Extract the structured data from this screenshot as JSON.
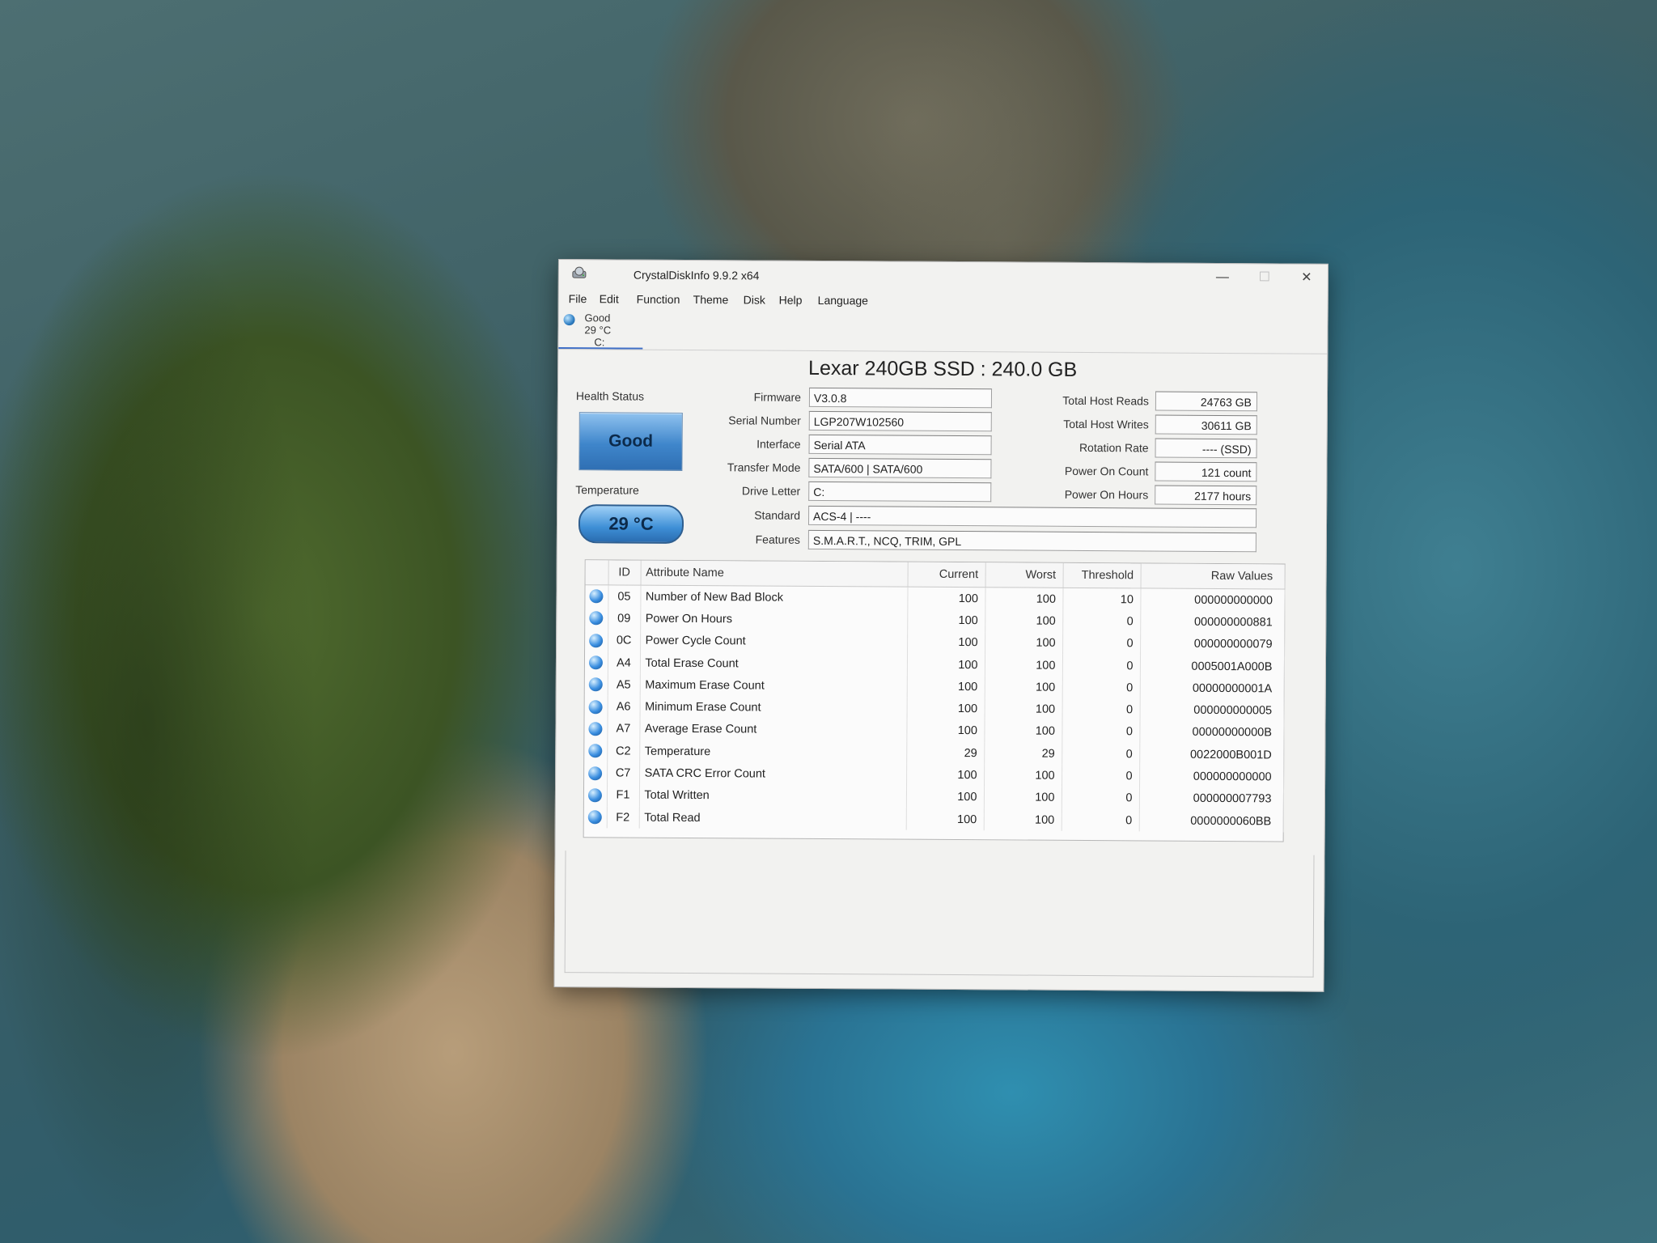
{
  "app": {
    "title": "CrystalDiskInfo 9.9.2 x64"
  },
  "window_controls": {
    "minimize": "—",
    "maximize": "☐",
    "close": "✕"
  },
  "menu": [
    "File",
    "Edit",
    "Function",
    "Theme",
    "Disk",
    "Help",
    "Language"
  ],
  "drive_tab": {
    "status": "Good",
    "temp": "29 °C",
    "letter": "C:"
  },
  "model_title": "Lexar 240GB SSD : 240.0 GB",
  "health": {
    "label": "Health Status",
    "value": "Good"
  },
  "temperature": {
    "label": "Temperature",
    "value": "29 °C"
  },
  "info_left": [
    {
      "label": "Firmware",
      "value": "V3.0.8"
    },
    {
      "label": "Serial Number",
      "value": "LGP207W102560"
    },
    {
      "label": "Interface",
      "value": "Serial ATA"
    },
    {
      "label": "Transfer Mode",
      "value": "SATA/600 | SATA/600"
    },
    {
      "label": "Drive Letter",
      "value": "C:"
    }
  ],
  "info_right": [
    {
      "label": "Total Host Reads",
      "value": "24763 GB"
    },
    {
      "label": "Total Host Writes",
      "value": "30611 GB"
    },
    {
      "label": "Rotation Rate",
      "value": "---- (SSD)"
    },
    {
      "label": "Power On Count",
      "value": "121 count"
    },
    {
      "label": "Power On Hours",
      "value": "2177 hours"
    }
  ],
  "standard": {
    "label": "Standard",
    "value": "ACS-4 | ----"
  },
  "features": {
    "label": "Features",
    "value": "S.M.A.R.T., NCQ, TRIM, GPL"
  },
  "smart_table": {
    "headers": [
      "ID",
      "Attribute Name",
      "Current",
      "Worst",
      "Threshold",
      "Raw Values"
    ],
    "rows": [
      {
        "id": "05",
        "name": "Number of New Bad Block",
        "current": "100",
        "worst": "100",
        "threshold": "10",
        "raw": "000000000000"
      },
      {
        "id": "09",
        "name": "Power On Hours",
        "current": "100",
        "worst": "100",
        "threshold": "0",
        "raw": "000000000881"
      },
      {
        "id": "0C",
        "name": "Power Cycle Count",
        "current": "100",
        "worst": "100",
        "threshold": "0",
        "raw": "000000000079"
      },
      {
        "id": "A4",
        "name": "Total Erase Count",
        "current": "100",
        "worst": "100",
        "threshold": "0",
        "raw": "0005001A000B"
      },
      {
        "id": "A5",
        "name": "Maximum Erase Count",
        "current": "100",
        "worst": "100",
        "threshold": "0",
        "raw": "00000000001A"
      },
      {
        "id": "A6",
        "name": "Minimum Erase Count",
        "current": "100",
        "worst": "100",
        "threshold": "0",
        "raw": "000000000005"
      },
      {
        "id": "A7",
        "name": "Average Erase Count",
        "current": "100",
        "worst": "100",
        "threshold": "0",
        "raw": "00000000000B"
      },
      {
        "id": "C2",
        "name": "Temperature",
        "current": "29",
        "worst": "29",
        "threshold": "0",
        "raw": "0022000B001D"
      },
      {
        "id": "C7",
        "name": "SATA CRC Error Count",
        "current": "100",
        "worst": "100",
        "threshold": "0",
        "raw": "000000000000"
      },
      {
        "id": "F1",
        "name": "Total Written",
        "current": "100",
        "worst": "100",
        "threshold": "0",
        "raw": "000000007793"
      },
      {
        "id": "F2",
        "name": "Total Read",
        "current": "100",
        "worst": "100",
        "threshold": "0",
        "raw": "0000000060BB"
      }
    ]
  }
}
